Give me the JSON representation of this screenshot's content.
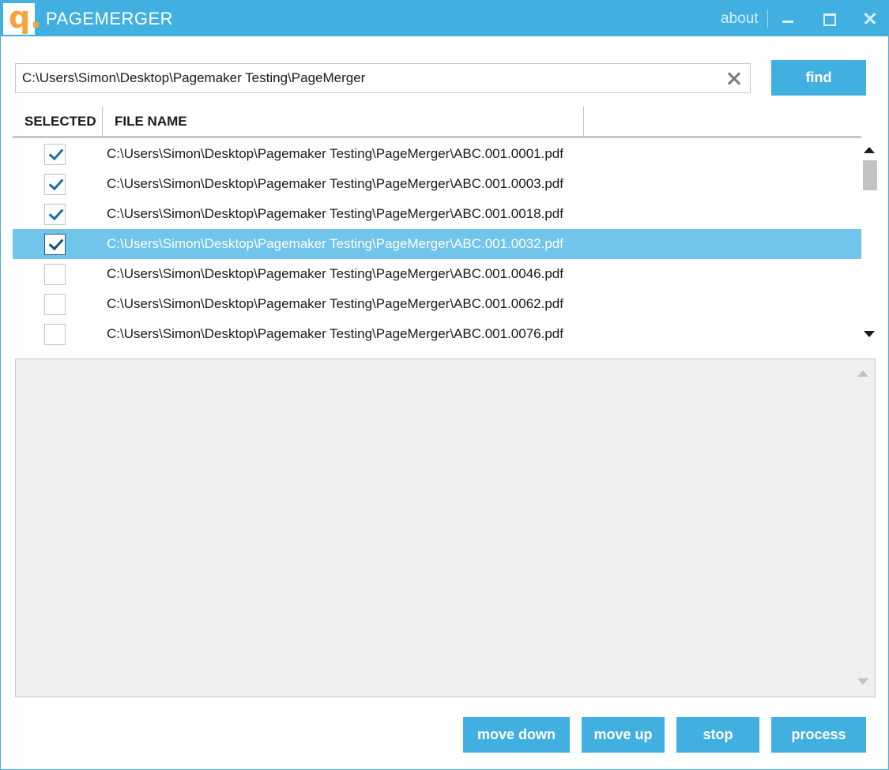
{
  "titlebar": {
    "logo_glyph": "q.",
    "title": "PAGEMERGER",
    "about": "about"
  },
  "search": {
    "path_value": "C:\\Users\\Simon\\Desktop\\Pagemaker Testing\\PageMerger",
    "find_label": "find"
  },
  "table": {
    "columns": [
      "SELECTED",
      "FILE NAME"
    ],
    "rows": [
      {
        "checked": true,
        "file": "C:\\Users\\Simon\\Desktop\\Pagemaker Testing\\PageMerger\\ABC.001.0001.pdf",
        "highlighted": false
      },
      {
        "checked": true,
        "file": "C:\\Users\\Simon\\Desktop\\Pagemaker Testing\\PageMerger\\ABC.001.0003.pdf",
        "highlighted": false
      },
      {
        "checked": true,
        "file": "C:\\Users\\Simon\\Desktop\\Pagemaker Testing\\PageMerger\\ABC.001.0018.pdf",
        "highlighted": false
      },
      {
        "checked": true,
        "file": "C:\\Users\\Simon\\Desktop\\Pagemaker Testing\\PageMerger\\ABC.001.0032.pdf",
        "highlighted": true
      },
      {
        "checked": false,
        "file": "C:\\Users\\Simon\\Desktop\\Pagemaker Testing\\PageMerger\\ABC.001.0046.pdf",
        "highlighted": false
      },
      {
        "checked": false,
        "file": "C:\\Users\\Simon\\Desktop\\Pagemaker Testing\\PageMerger\\ABC.001.0062.pdf",
        "highlighted": false
      },
      {
        "checked": false,
        "file": "C:\\Users\\Simon\\Desktop\\Pagemaker Testing\\PageMerger\\ABC.001.0076.pdf",
        "highlighted": false
      }
    ]
  },
  "actions": {
    "move_down": "move down",
    "move_up": "move up",
    "stop": "stop",
    "process": "process"
  },
  "colors": {
    "accent": "#41b0e0",
    "selected_row": "#71c4ea",
    "log_background": "#f0f0f0"
  }
}
